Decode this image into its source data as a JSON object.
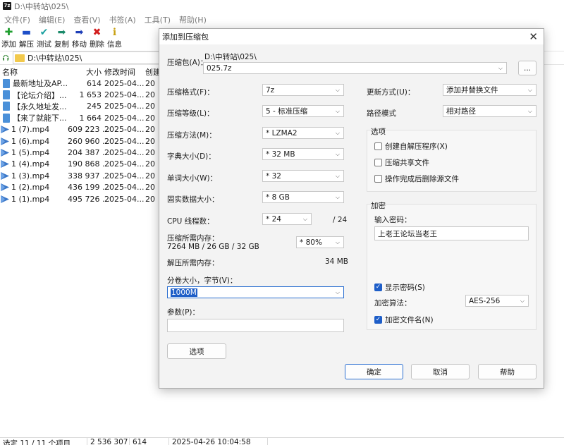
{
  "window": {
    "title": "D:\\中转站\\025\\",
    "app_icon": "7z"
  },
  "menu": [
    "文件(F)",
    "编辑(E)",
    "查看(V)",
    "书签(A)",
    "工具(T)",
    "帮助(H)"
  ],
  "toolbar": [
    {
      "label": "添加",
      "icon": "plus-icon",
      "glyph": "✚",
      "color": "#1e9e2e"
    },
    {
      "label": "解压",
      "icon": "minus-icon",
      "glyph": "▬",
      "color": "#1e4fc8"
    },
    {
      "label": "测试",
      "icon": "check-icon",
      "glyph": "✔",
      "color": "#1aa0a0"
    },
    {
      "label": "复制",
      "icon": "arrow-right-icon",
      "glyph": "➡",
      "color": "#1a8a6a"
    },
    {
      "label": "移动",
      "icon": "move-icon",
      "glyph": "➡",
      "color": "#1e3fb8"
    },
    {
      "label": "删除",
      "icon": "delete-icon",
      "glyph": "✖",
      "color": "#d21e1e"
    },
    {
      "label": "信息",
      "icon": "info-icon",
      "glyph": "ℹ",
      "color": "#c8a010"
    }
  ],
  "address": "D:\\中转站\\025\\",
  "columns": {
    "name": "名称",
    "size": "大小",
    "modified": "修改时间",
    "created": "创建"
  },
  "files": [
    {
      "name": "最新地址及AP...",
      "size": "614",
      "modified": "2025-04...",
      "created": "20",
      "type": "doc"
    },
    {
      "name": "【论坛介绍】...",
      "size": "1 653",
      "modified": "2025-04...",
      "created": "20",
      "type": "doc"
    },
    {
      "name": "【永久地址发...",
      "size": "245",
      "modified": "2025-04...",
      "created": "20",
      "type": "doc"
    },
    {
      "name": "【来了就能下...",
      "size": "1 664",
      "modified": "2025-04...",
      "created": "20",
      "type": "doc"
    },
    {
      "name": "1 (7).mp4",
      "size": "609 223 ...",
      "modified": "2025-04...",
      "created": "20",
      "type": "video"
    },
    {
      "name": "1 (6).mp4",
      "size": "260 960 ...",
      "modified": "2025-04...",
      "created": "20",
      "type": "video"
    },
    {
      "name": "1 (5).mp4",
      "size": "204 387 ...",
      "modified": "2025-04...",
      "created": "20",
      "type": "video"
    },
    {
      "name": "1 (4).mp4",
      "size": "190 868 ...",
      "modified": "2025-04...",
      "created": "20",
      "type": "video"
    },
    {
      "name": "1 (3).mp4",
      "size": "338 937 ...",
      "modified": "2025-04...",
      "created": "20",
      "type": "video"
    },
    {
      "name": "1 (2).mp4",
      "size": "436 199 ...",
      "modified": "2025-04...",
      "created": "20",
      "type": "video"
    },
    {
      "name": "1 (1).mp4",
      "size": "495 726 ...",
      "modified": "2025-04...",
      "created": "20",
      "type": "video"
    }
  ],
  "status": {
    "selected": "选定 11 / 11 个项目",
    "total": "2 536 307 ...",
    "size": "614",
    "date": "2025-04-26 10:04:58"
  },
  "dialog": {
    "title": "添加到压缩包",
    "archive_label": "压缩包(A)：",
    "archive_dir": "D:\\中转站\\025\\",
    "archive_name": "025.7z",
    "browse": "...",
    "format_label": "压缩格式(F)：",
    "format": "7z",
    "level_label": "压缩等级(L)：",
    "level": "5 - 标准压缩",
    "method_label": "压缩方法(M)：",
    "method": "* LZMA2",
    "dict_label": "字典大小(D)：",
    "dict": "* 32 MB",
    "word_label": "单词大小(W)：",
    "word": "* 32",
    "solid_label": "固实数据大小：",
    "solid": "* 8 GB",
    "cpu_label": "CPU 线程数：",
    "cpu": "* 24",
    "cpu_max": "/ 24",
    "mem_label": "压缩所需内存：",
    "mem_value": "7264 MB / 26 GB / 32 GB",
    "mem_pct": "* 80%",
    "decomp_label": "解压所需内存：",
    "decomp_value": "34 MB",
    "split_label": "分卷大小，字节(V)：",
    "split": "1000M",
    "params_label": "参数(P)：",
    "params": "",
    "options_button": "选项",
    "update_label": "更新方式(U)：",
    "update": "添加并替换文件",
    "path_label": "路径模式",
    "path": "相对路径",
    "options_group": "选项",
    "opt_sfx": "创建自解压程序(X)",
    "opt_shared": "压缩共享文件",
    "opt_delete": "操作完成后删除源文件",
    "enc_group": "加密",
    "pwd_label": "输入密码：",
    "pwd": "上老王论坛当老王",
    "show_pwd": "显示密码(S)",
    "enc_method_label": "加密算法：",
    "enc_method": "AES-256",
    "enc_names": "加密文件名(N)",
    "ok": "确定",
    "cancel": "取消",
    "help": "帮助"
  }
}
